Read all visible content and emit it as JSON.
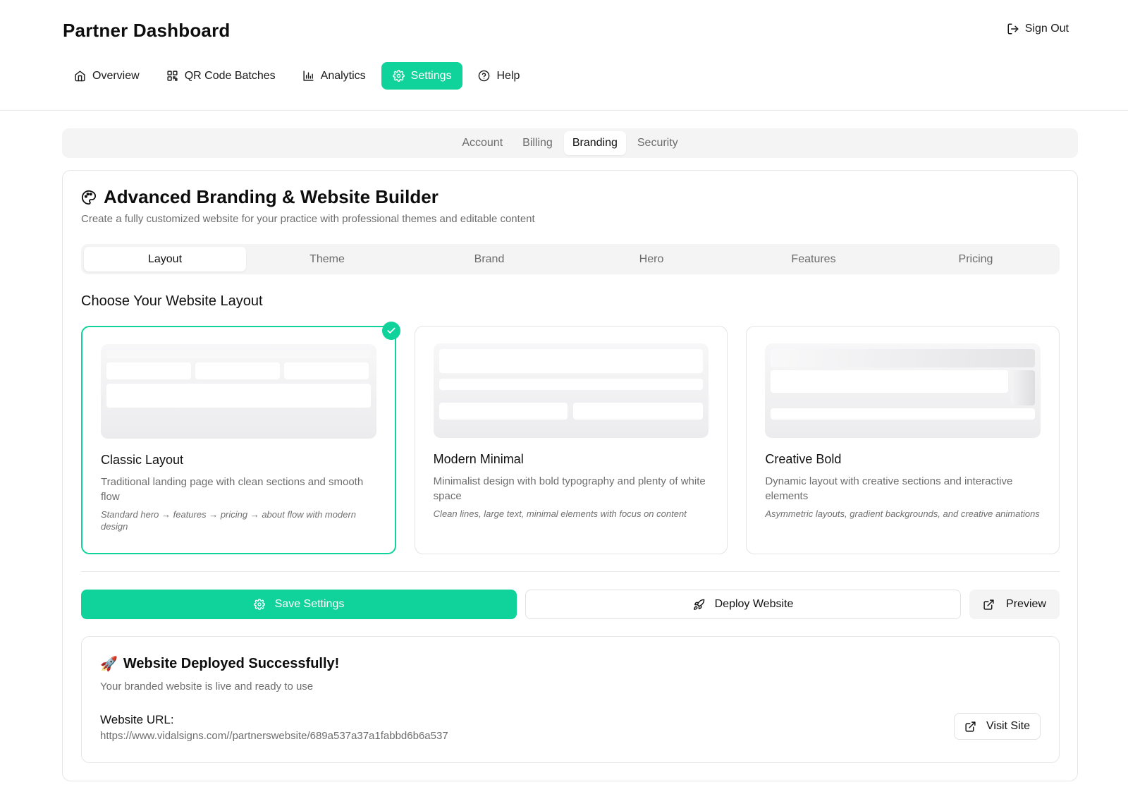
{
  "header": {
    "title": "Partner Dashboard",
    "sign_out": "Sign Out",
    "nav": [
      {
        "label": "Overview",
        "icon": "home-icon"
      },
      {
        "label": "QR Code Batches",
        "icon": "qr-code-icon"
      },
      {
        "label": "Analytics",
        "icon": "bar-chart-icon"
      },
      {
        "label": "Settings",
        "icon": "gear-icon",
        "active": true
      },
      {
        "label": "Help",
        "icon": "help-circle-icon"
      }
    ]
  },
  "settings_tabs": [
    {
      "label": "Account"
    },
    {
      "label": "Billing"
    },
    {
      "label": "Branding",
      "active": true
    },
    {
      "label": "Security"
    }
  ],
  "branding": {
    "title": "Advanced Branding & Website Builder",
    "subtitle": "Create a fully customized website for your practice with professional themes and editable content",
    "tabs": [
      {
        "label": "Layout",
        "active": true
      },
      {
        "label": "Theme"
      },
      {
        "label": "Brand"
      },
      {
        "label": "Hero"
      },
      {
        "label": "Features"
      },
      {
        "label": "Pricing"
      }
    ],
    "section_title": "Choose Your Website Layout",
    "layouts": [
      {
        "name": "Classic Layout",
        "description": "Traditional landing page with clean sections and smooth flow",
        "note": "Standard hero → features → pricing → about flow with modern design",
        "selected": true
      },
      {
        "name": "Modern Minimal",
        "description": "Minimalist design with bold typography and plenty of white space",
        "note": "Clean lines, large text, minimal elements with focus on content"
      },
      {
        "name": "Creative Bold",
        "description": "Dynamic layout with creative sections and interactive elements",
        "note": "Asymmetric layouts, gradient backgrounds, and creative animations"
      }
    ],
    "actions": {
      "save": "Save Settings",
      "deploy": "Deploy Website",
      "preview": "Preview"
    },
    "deployment": {
      "emoji": "🚀",
      "title": "Website Deployed Successfully!",
      "subtitle": "Your branded website is live and ready to use",
      "url_label": "Website URL:",
      "url": "https://www.vidalsigns.com//partnerswebsite/689a537a37a1fabbd6b6a537",
      "visit": "Visit Site"
    }
  },
  "colors": {
    "accent": "#10d39b",
    "muted_text": "#6e6e6e",
    "tab_bg": "#f4f4f5"
  }
}
